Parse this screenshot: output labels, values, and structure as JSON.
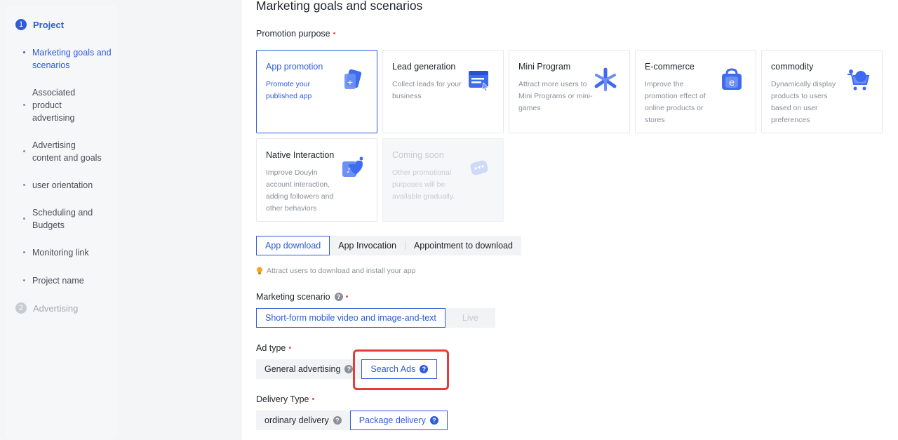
{
  "sidebar": {
    "steps": [
      {
        "num": "1",
        "label": "Project"
      },
      {
        "num": "2",
        "label": "Advertising"
      }
    ],
    "items": [
      {
        "label": "Marketing goals and scenarios"
      },
      {
        "label": "Associated product advertising"
      },
      {
        "label": "Advertising content and goals"
      },
      {
        "label": "user orientation"
      },
      {
        "label": "Scheduling and Budgets"
      },
      {
        "label": "Monitoring link"
      },
      {
        "label": "Project name"
      }
    ]
  },
  "main": {
    "title": "Marketing goals and scenarios",
    "promotion_purpose": {
      "label": "Promotion purpose",
      "required": "•",
      "cards": [
        {
          "title": "App promotion",
          "desc": "Promote your published app",
          "icon": "app-card-icon"
        },
        {
          "title": "Lead generation",
          "desc": "Collect leads for your business",
          "icon": "form-window-icon"
        },
        {
          "title": "Mini Program",
          "desc": "Attract more users to Mini Programs or mini-games",
          "icon": "asterisk-icon"
        },
        {
          "title": "E-commerce",
          "desc": "Improve the promotion effect of online products or stores",
          "icon": "shopping-bag-icon"
        },
        {
          "title": "commodity",
          "desc": "Dynamically display products to users based on user preferences",
          "icon": "shopping-cart-icon"
        },
        {
          "title": "Native Interaction",
          "desc": "Improve Douyin account interaction, adding followers and other behaviors",
          "icon": "douyin-heart-icon"
        },
        {
          "title": "Coming soon",
          "desc": "Other promotional purposes will be available gradually.",
          "icon": "chat-bubble-icon"
        }
      ]
    },
    "app_modes": {
      "options": [
        "App download",
        "App Invocation",
        "Appointment to download"
      ],
      "hint": "Attract users to download and install your app"
    },
    "marketing_scenario": {
      "label": "Marketing scenario",
      "required": "•",
      "options": [
        "Short-form mobile video and image-and-text",
        "Live"
      ]
    },
    "ad_type": {
      "label": "Ad type",
      "required": "•",
      "options": [
        "General advertising",
        "Search Ads"
      ]
    },
    "delivery_type": {
      "label": "Delivery Type",
      "required": "•",
      "options": [
        "ordinary delivery",
        "Package delivery"
      ]
    }
  },
  "colors": {
    "accent": "#2f5bd7",
    "highlight": "#e13d3d"
  }
}
